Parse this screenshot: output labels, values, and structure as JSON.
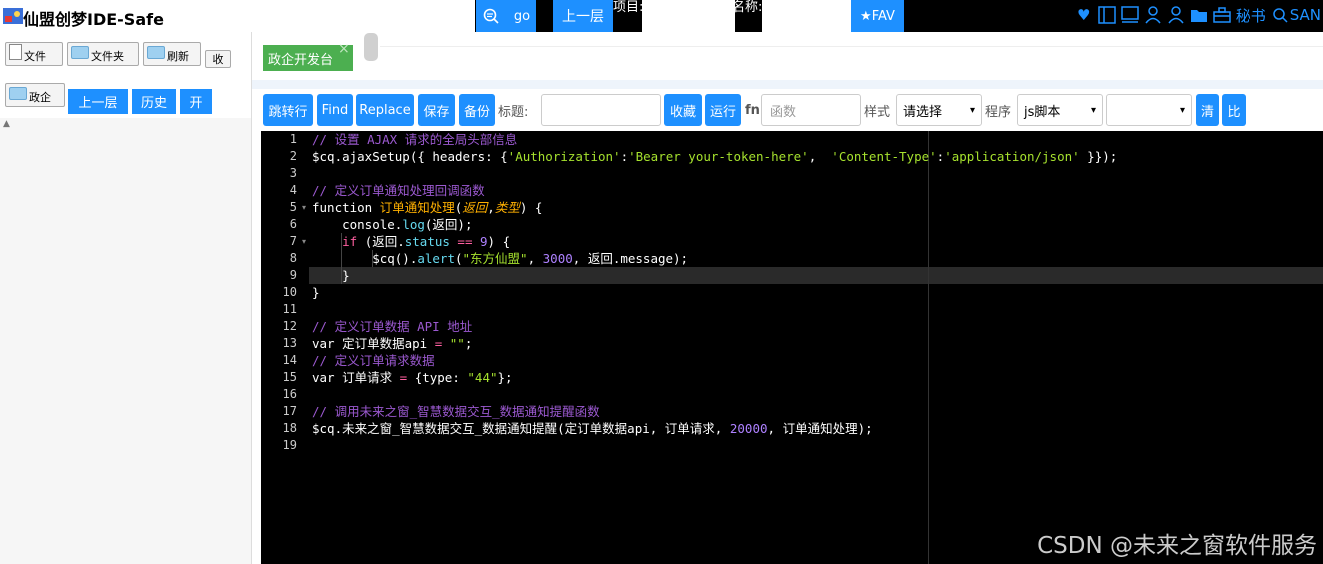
{
  "header": {
    "app_title": "仙盟创梦IDE-Safe",
    "go_label": "go",
    "up_label": "上一层",
    "project_label": "项目:",
    "name_label": "名称:",
    "fav_label": "★FAV",
    "secretary_label": "秘书",
    "san_label": "SAN",
    "icons": [
      "heart-icon",
      "layout-icon",
      "monitor-icon",
      "user-icon",
      "user-icon",
      "folder-icon",
      "toolbox-icon",
      "search-icon"
    ]
  },
  "left": {
    "file_label": "文件",
    "folder_label": "文件夹",
    "refresh_label": "刷新",
    "collapse_label": "收",
    "zhengqi_label": "政企",
    "up_label": "上一层",
    "history_label": "历史",
    "open_label": "开"
  },
  "tabs": [
    {
      "label": "政企开发台",
      "close": "×"
    }
  ],
  "toolbar": {
    "jump_label": "跳转行",
    "find_label": "Find",
    "replace_label": "Replace",
    "save_label": "保存",
    "backup_label": "备份",
    "title_label": "标题:",
    "favorite_label": "收藏",
    "run_label": "运行",
    "fn_label": "fn",
    "fn_placeholder": "函数",
    "style_label": "样式",
    "style_value": "请选择",
    "program_label": "程序",
    "program_value": "js脚本",
    "clear_label": "清",
    "compare_label": "比"
  },
  "editor": {
    "line_numbers": [
      "1",
      "2",
      "3",
      "4",
      "5",
      "6",
      "7",
      "8",
      "9",
      "10",
      "11",
      "12",
      "13",
      "14",
      "15",
      "16",
      "17",
      "18",
      "19"
    ],
    "lines": {
      "l1": "// 设置 AJAX 请求的全局头部信息",
      "l2a": "$cq.ajaxSetup({ headers: {",
      "l2b": "'Authorization'",
      "l2c": ":",
      "l2d": "'Bearer your-token-here'",
      "l2e": ",  ",
      "l2f": "'Content-Type'",
      "l2g": ":",
      "l2h": "'application/json'",
      "l2i": " }});",
      "l4": "// 定义订单通知处理回调函数",
      "l5a": "function ",
      "l5b": "订单通知处理",
      "l5c": "(",
      "l5d": "返回",
      "l5e": ",",
      "l5f": "类型",
      "l5g": ") {",
      "l6a": "    console.",
      "l6b": "log",
      "l6c": "(返回);",
      "l7a": "    ",
      "l7b": "if",
      "l7c": " (返回.",
      "l7d": "status",
      "l7e": " == ",
      "l7f": "9",
      "l7g": ") {",
      "l8a": "        $cq().",
      "l8b": "alert",
      "l8c": "(",
      "l8d": "\"东方仙盟\"",
      "l8e": ", ",
      "l8f": "3000",
      "l8g": ", 返回.message);",
      "l9": "    }",
      "l10": "}",
      "l12": "// 定义订单数据 API 地址",
      "l13a": "var 定订单数据api ",
      "l13b": "=",
      "l13c": " ",
      "l13d": "\"\"",
      "l13e": ";",
      "l14": "// 定义订单请求数据",
      "l15a": "var 订单请求 ",
      "l15b": "=",
      "l15c": " {type: ",
      "l15d": "\"44\"",
      "l15e": "};",
      "l17": "// 调用未来之窗_智慧数据交互_数据通知提醒函数",
      "l18a": "$cq.未来之窗_智慧数据交互_数据通知提醒(定订单数据api, 订单请求, ",
      "l18b": "20000",
      "l18c": ", 订单通知处理);"
    }
  },
  "watermark": "CSDN @未来之窗软件服务"
}
